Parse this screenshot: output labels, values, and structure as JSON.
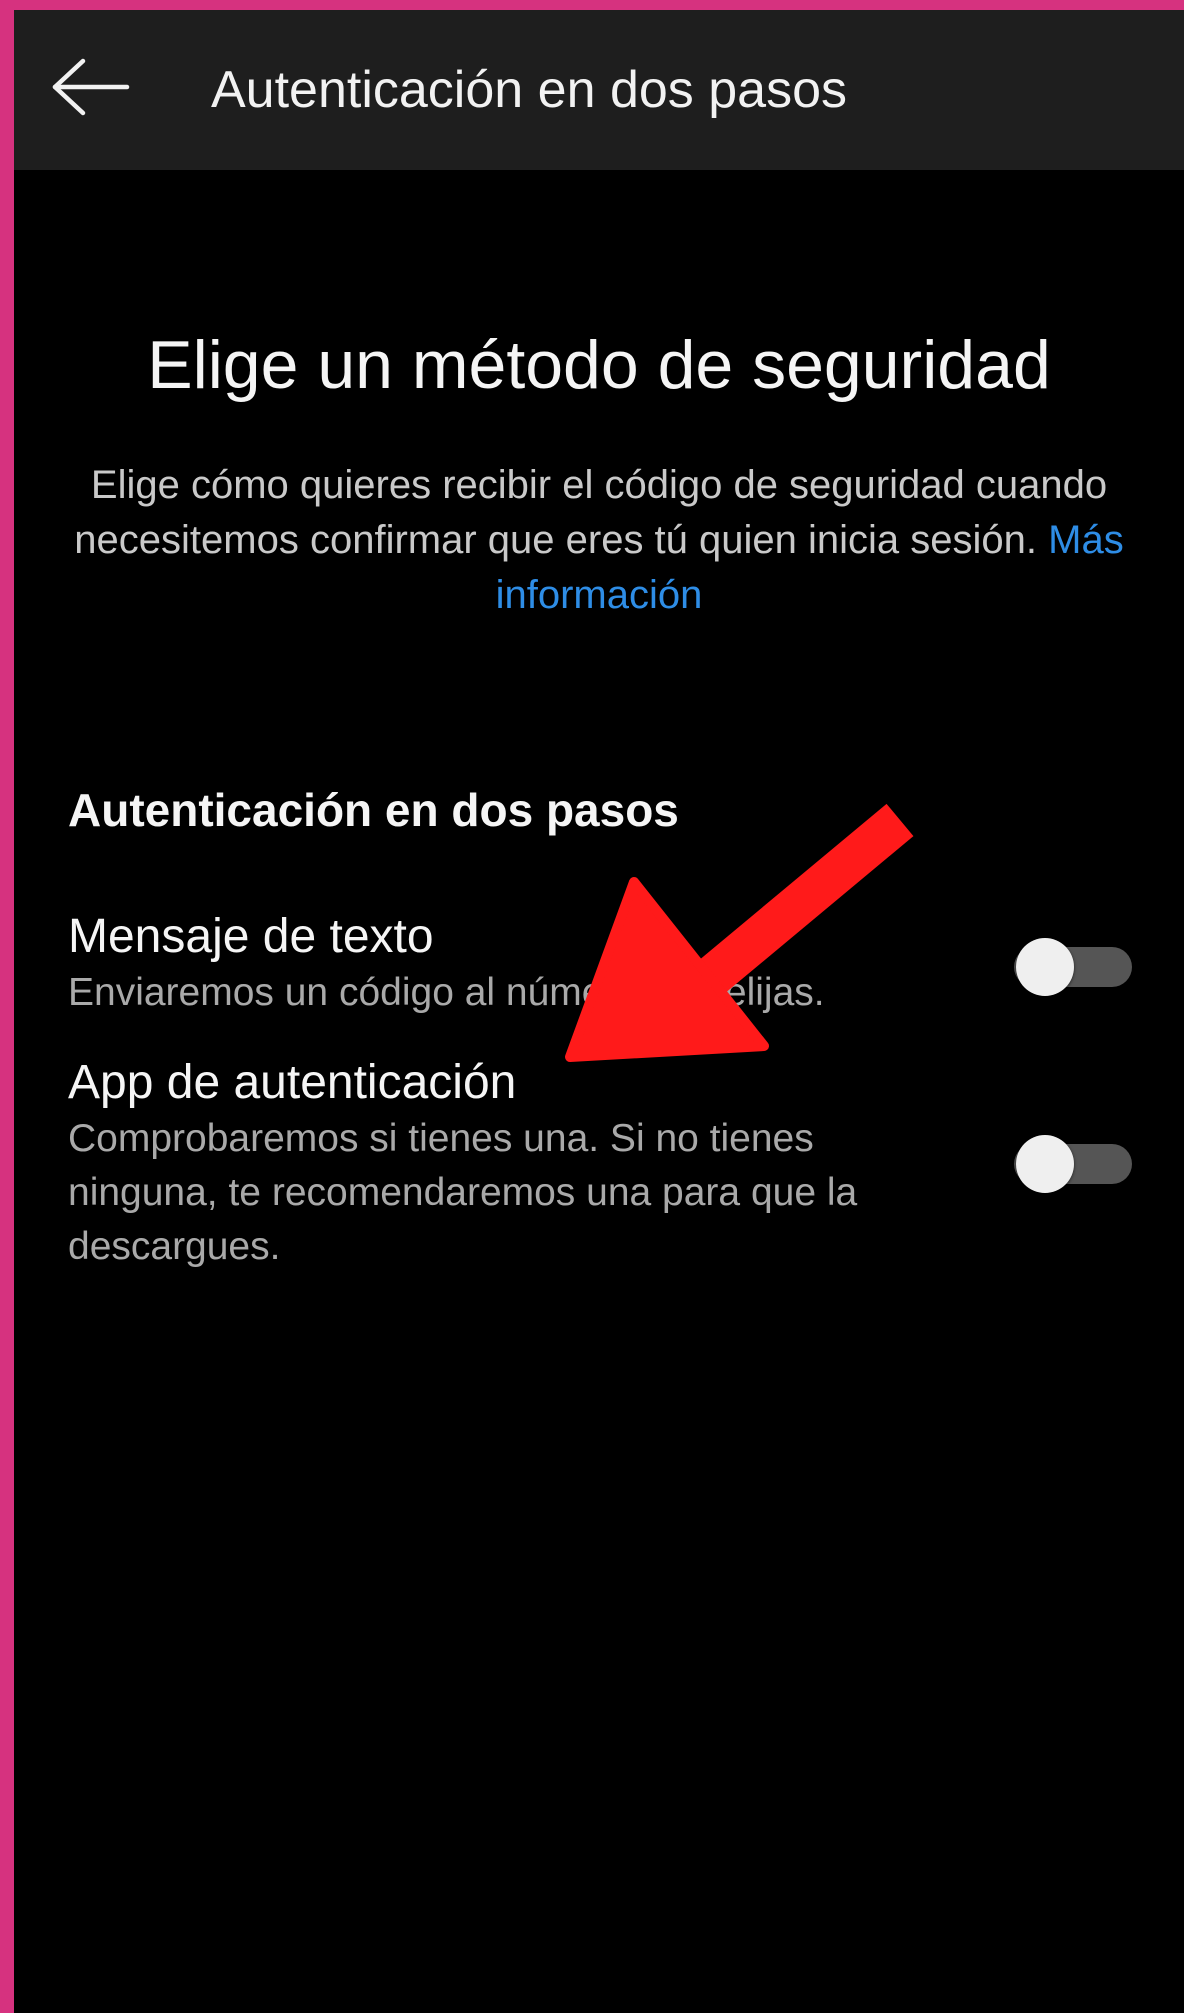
{
  "app_bar": {
    "back_icon": "arrow-left-icon",
    "title": "Autenticación en dos pasos"
  },
  "main": {
    "heading": "Elige un método de seguridad",
    "description": "Elige cómo quieres recibir el código de seguridad cuando necesitemos confirmar que eres tú quien inicia sesión.",
    "learn_more": "Más información"
  },
  "section": {
    "title": "Autenticación en dos pasos",
    "options": [
      {
        "title": "Mensaje de texto",
        "description": "Enviaremos un código al número que elijas.",
        "enabled": false
      },
      {
        "title": "App de autenticación",
        "description": "Comprobaremos si tienes una. Si no tienes ninguna, te recomendaremos una para que la descargues.",
        "enabled": false
      }
    ]
  },
  "colors": {
    "frame": "#d6327f",
    "background": "#000000",
    "app_bar": "#1e1e1e",
    "link": "#2e8de6",
    "annotation_arrow": "#ff1a1a"
  }
}
